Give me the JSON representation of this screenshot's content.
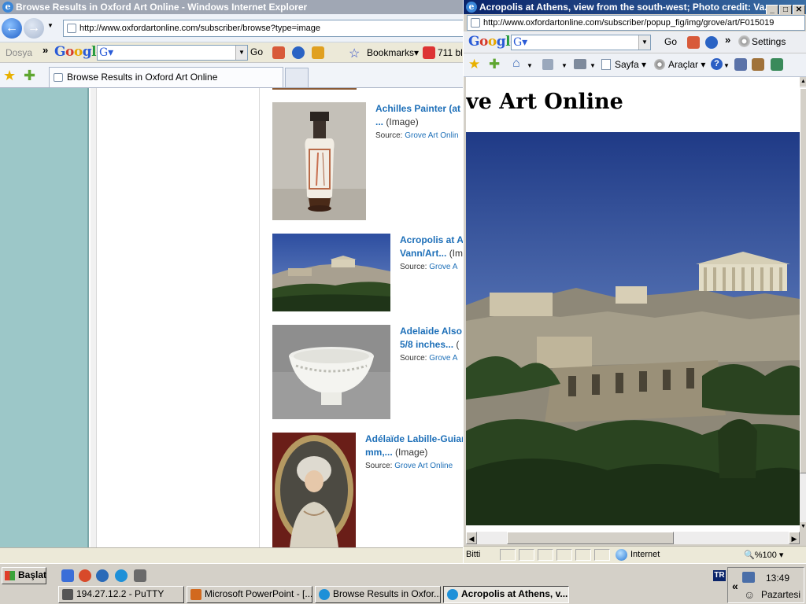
{
  "left_window": {
    "title": "Browse Results in Oxford Art Online - Windows Internet Explorer",
    "address": "http://www.oxfordartonline.com/subscriber/browse?type=image",
    "google_bar": {
      "menu_label": "Dosya",
      "chevron": "»",
      "go_label": "Go",
      "bookmarks_label": "Bookmarks",
      "blocked_label": "711 bl"
    },
    "tab_label": "Browse Results in Oxford Art Online",
    "results": [
      {
        "title_line1": "Achilles Painter (at",
        "title_line2": "...",
        "type": "(Image)",
        "source_label": "Source:",
        "source": "Grove Art Onlin"
      },
      {
        "title_line1": "Acropolis at A",
        "title_line2": "Vann/Art...",
        "type": "(Im",
        "source_label": "Source:",
        "source": "Grove A"
      },
      {
        "title_line1": "Adelaide Also",
        "title_line2": "5/8 inches...",
        "type": "(",
        "source_label": "Source:",
        "source": "Grove A"
      },
      {
        "title_line1": "Adélaïde Labille-Guiar",
        "title_line2": "mm,...",
        "type": "(Image)",
        "source_label": "Source:",
        "source": "Grove Art Online"
      }
    ]
  },
  "right_window": {
    "title": "Acropolis at Athens, view from the south-west; Photo credit: Va...",
    "address": "http://www.oxfordartonline.com/subscriber/popup_fig/img/grove/art/F015019",
    "go_label": "Go",
    "chevron": "»",
    "settings_label": "Settings",
    "cmd": {
      "page_label": "Sayfa",
      "tools_label": "Araçlar"
    },
    "heading": "ve Art Online",
    "status": {
      "left": "Bitti",
      "zone": "Internet",
      "zoom": "%100"
    }
  },
  "taskbar": {
    "start_label": "Başlat",
    "tasks": [
      {
        "label": "194.27.12.2 - PuTTY"
      },
      {
        "label": "Microsoft PowerPoint - [..."
      },
      {
        "label": "Browse Results in Oxfor..."
      },
      {
        "label": "Acropolis at Athens, v..."
      }
    ],
    "lang": "TR",
    "time": "13:49",
    "day": "Pazartesi"
  },
  "icons": {
    "ie": "ie-icon",
    "back": "back-arrow-icon",
    "forward": "forward-arrow-icon",
    "favorites": "favorites-star-icon",
    "add_favorite": "add-favorite-icon",
    "home": "home-icon",
    "feeds": "feeds-icon",
    "print": "print-icon",
    "page": "page-icon",
    "tools": "tools-gear-icon",
    "help": "help-icon",
    "globe": "internet-globe-icon",
    "windows_flag": "windows-flag-icon"
  },
  "colors": {
    "link": "#1d6fb8",
    "active_title": "#0a246a",
    "inactive_title": "#a0a7b4",
    "sidebar_teal": "#9cc7c8"
  }
}
